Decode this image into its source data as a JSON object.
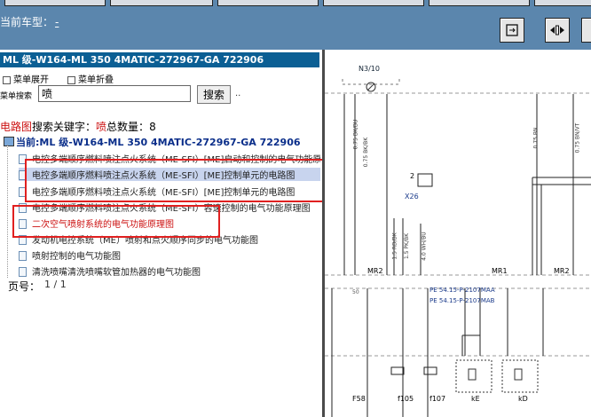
{
  "topbar": {
    "current_model_label": "当前车型：",
    "current_model_link": "-",
    "accent": "#5b86ad"
  },
  "left_panel": {
    "path_title": "ML 级-W164-ML 350 4MATIC-272967-GA 722906",
    "expand_menu": "菜单展开",
    "collapse_menu": "菜单折叠",
    "search_label": "菜单搜索",
    "search_value": "喷",
    "search_button": "搜索",
    "search_extra": "..",
    "summary": {
      "category": "电路图",
      "keyword_label": "搜索关键字：",
      "keyword": "喷",
      "count_label": "总数量：",
      "count": "8"
    },
    "tree_root_prefix": "当前:",
    "tree_root": "ML 级-W164-ML 350 4MATIC-272967-GA 722906",
    "results": [
      "电控多端顺序燃料喷注点火系统（ME-SFI）[ME]启动和控制的电气功能原理图",
      "电控多端顺序燃料喷注点火系统（ME-SFI）[ME]控制单元的电路图",
      "电控多端顺序燃料喷注点火系统（ME-SFI）[ME]控制单元的电路图",
      "电控多端顺序燃料喷注点火系统（ME-SFI）容速控制的电气功能原理图",
      "二次空气喷射系统的电气功能原理图",
      "发动机电控系统（ME）喷射和点火顺序同步的电气功能图",
      "喷射控制的电气功能图",
      "清洗喷嘴清洗喷嘴软管加热器的电气功能图"
    ],
    "page_label": "页号：",
    "page_value": "1 / 1",
    "highlight_color": "#e02020"
  },
  "diagram": {
    "component_top": "N3/10",
    "wires_left": [
      "0.75 BK/BU",
      "0.75 BK/BK"
    ],
    "wires_right": [
      "0.75 BN",
      "0.75 BN/VT"
    ],
    "switch_pin": "2",
    "switch_label": "X26",
    "mid_wires": [
      "1.5 RD/BK",
      "1.5 PK/BK",
      "4.0 WH/BU"
    ],
    "mr_labels": [
      "MR2",
      "MR1",
      "MR2"
    ],
    "pin_50": "50",
    "pe_links": [
      "PE 54.15-P-2107MAA",
      "PE 54.15-P-2107MAB"
    ],
    "bottom_labels": [
      "F58",
      "f105",
      "f107",
      "kE",
      "kD"
    ]
  }
}
